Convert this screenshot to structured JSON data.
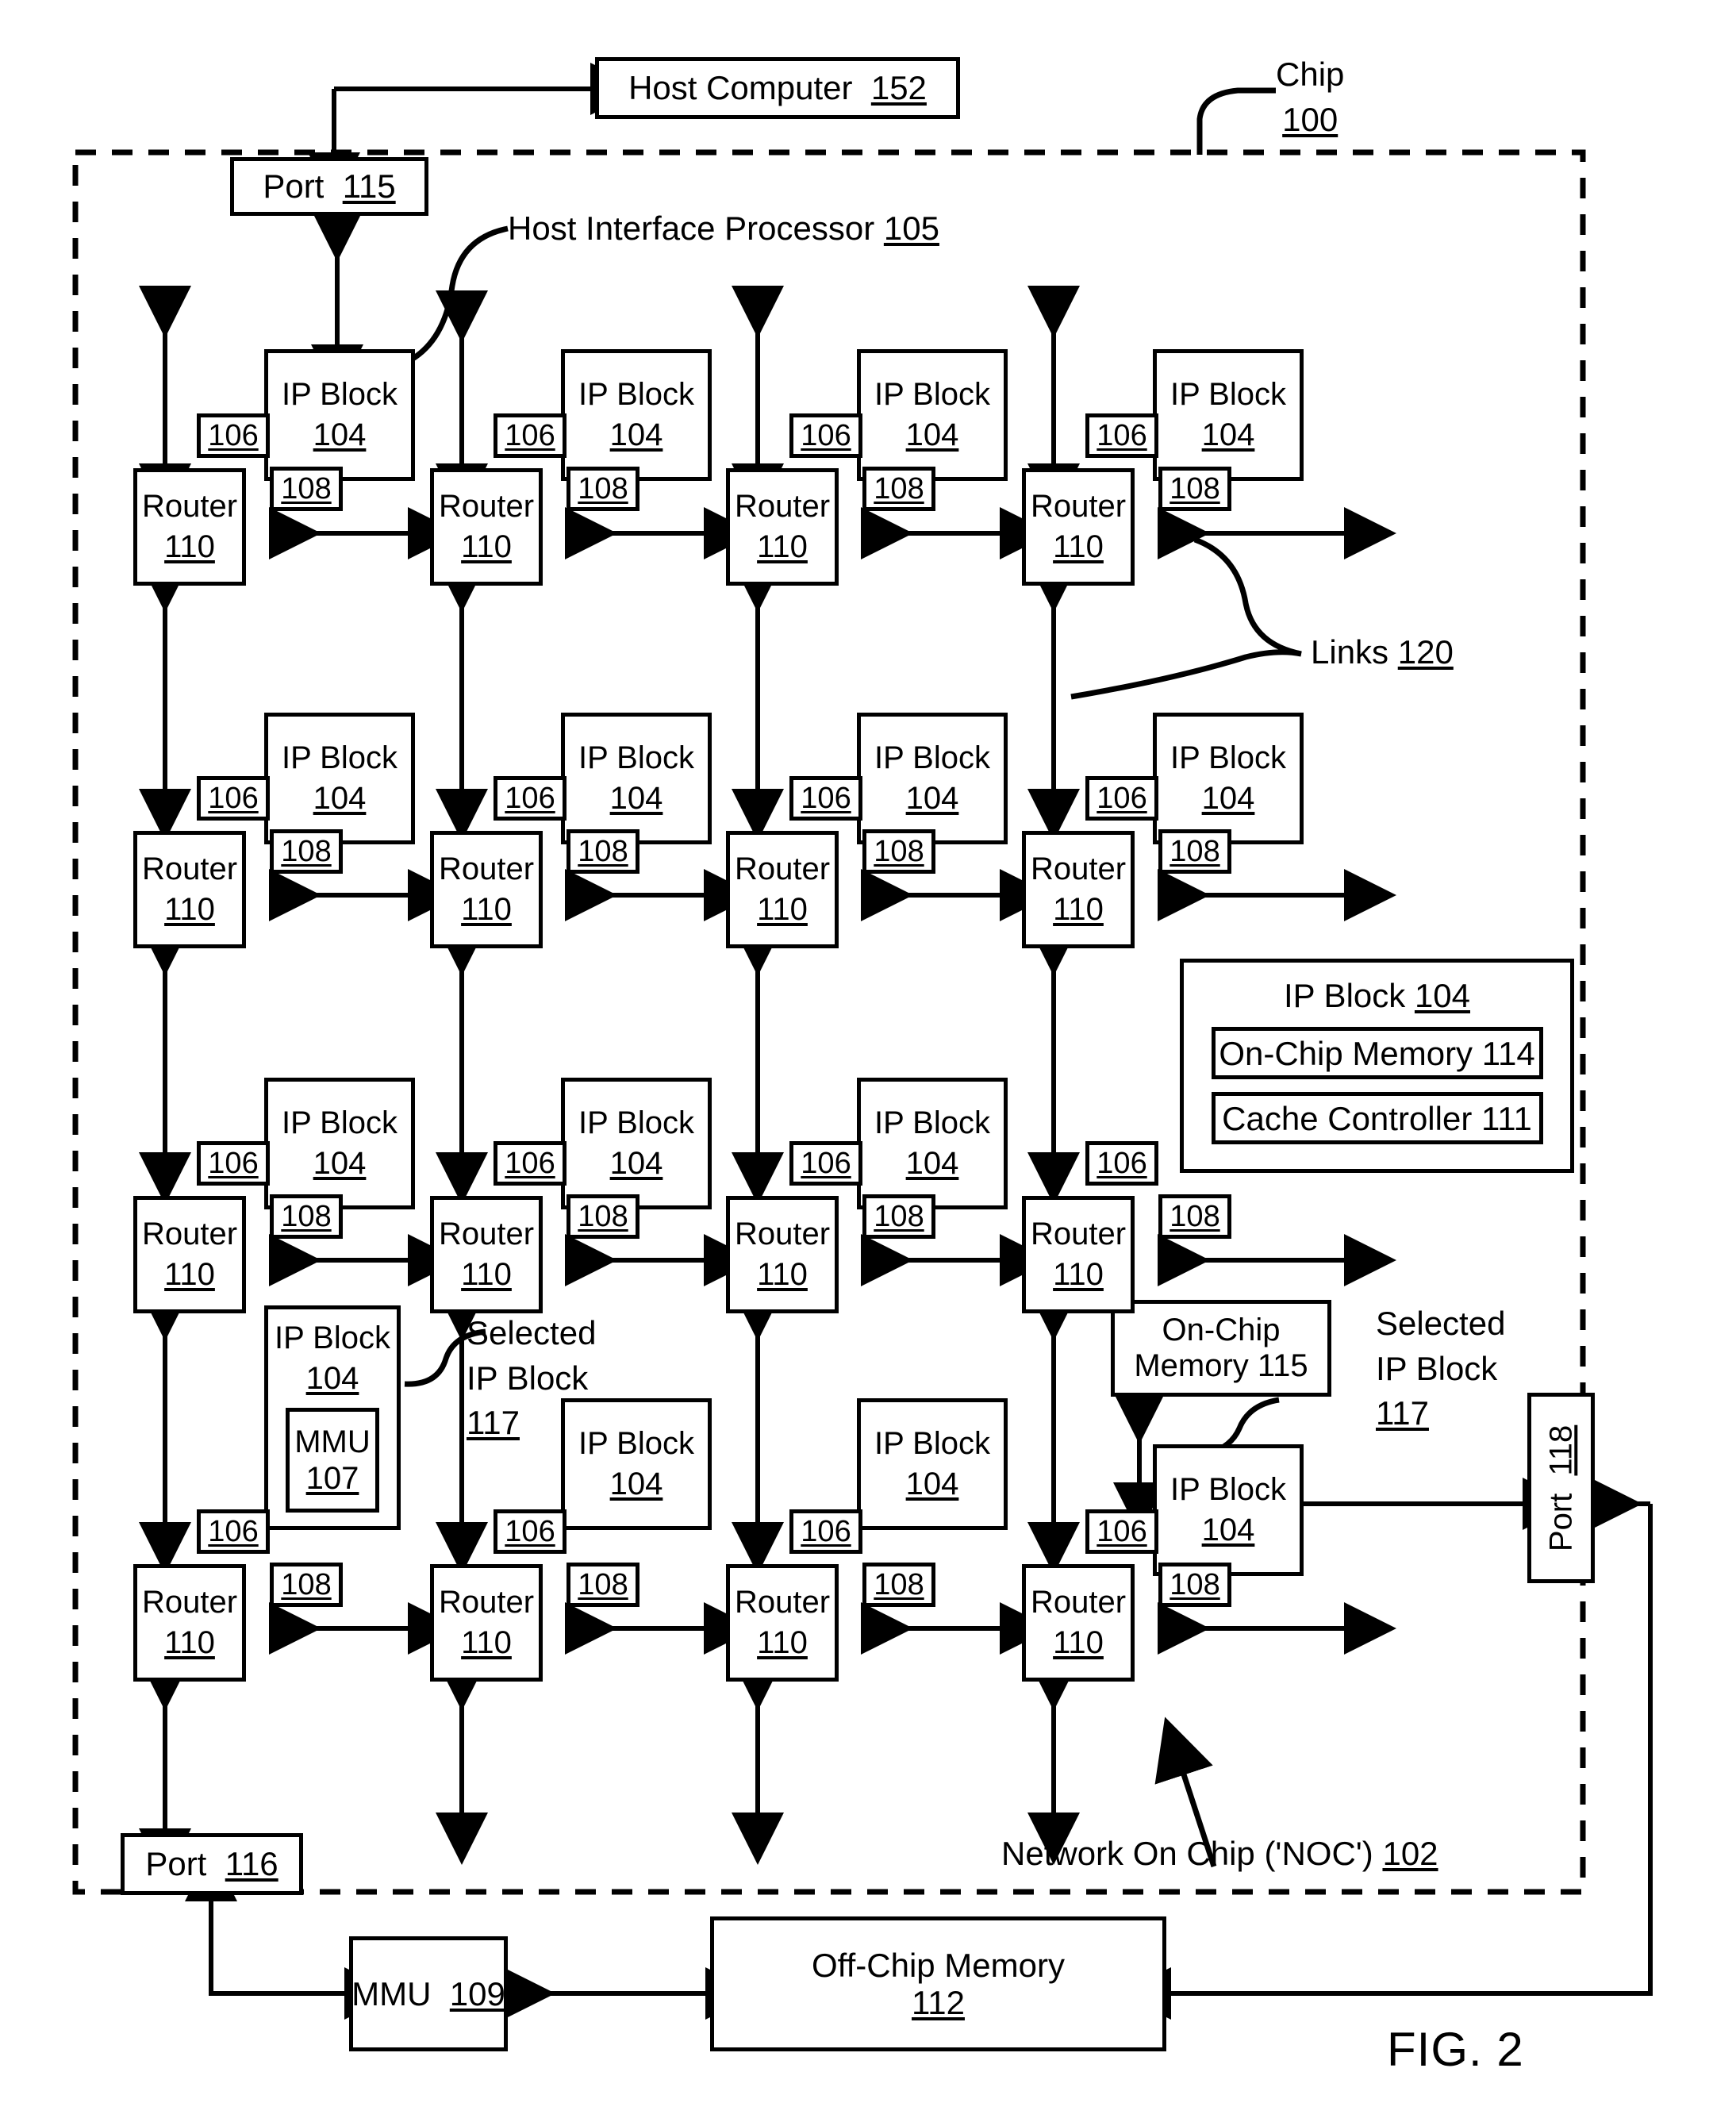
{
  "figure": {
    "number": "FIG. 2",
    "chip_label": {
      "line1": "Chip",
      "line2": "100"
    },
    "noc_label": "Network On Chip ('NOC') 102",
    "links_label": {
      "text": "Links",
      "ref": "120"
    },
    "host_interface_label": {
      "text": "Host Interface Processor",
      "ref": "105"
    },
    "selected_ip_left": {
      "line1": "Selected",
      "line2": "IP Block",
      "line3": "117"
    },
    "selected_ip_right": {
      "line1": "Selected",
      "line2": "IP Block",
      "line3": "117"
    }
  },
  "host_computer": {
    "title": "Host Computer",
    "ref": "152"
  },
  "ports": {
    "top": {
      "title": "Port",
      "ref": "115"
    },
    "bottom": {
      "title": "Port",
      "ref": "116"
    },
    "right": {
      "title": "Port",
      "ref": "118"
    }
  },
  "offchip": {
    "mmu": {
      "title": "MMU",
      "ref": "109"
    },
    "memory": {
      "title": "Off-Chip Memory",
      "ref": "112"
    }
  },
  "cell": {
    "ip_title": "IP Block",
    "ip_ref": "104",
    "router_title": "Router",
    "router_ref": "110",
    "tag_106": "106",
    "tag_108": "108"
  },
  "detail_ip_block": {
    "header_title": "IP Block",
    "header_ref": "104",
    "on_chip_memory": "On-Chip Memory 114",
    "cache_controller": "Cache Controller 111"
  },
  "mmu_in_ip": {
    "title": "MMU",
    "ref": "107"
  },
  "on_chip_memory_115": {
    "line1": "On-Chip",
    "line2": "Memory 115"
  },
  "grid": {
    "rows": 4,
    "cols": 4,
    "cells": [
      [
        {
          "type": "standard"
        },
        {
          "type": "standard"
        },
        {
          "type": "standard"
        },
        {
          "type": "standard"
        }
      ],
      [
        {
          "type": "standard"
        },
        {
          "type": "standard"
        },
        {
          "type": "standard"
        },
        {
          "type": "standard"
        }
      ],
      [
        {
          "type": "standard"
        },
        {
          "type": "standard"
        },
        {
          "type": "standard"
        },
        {
          "type": "detail"
        }
      ],
      [
        {
          "type": "mmu"
        },
        {
          "type": "standard"
        },
        {
          "type": "standard"
        },
        {
          "type": "selected"
        }
      ]
    ]
  },
  "colors": {
    "ink": "#000000",
    "paper": "#ffffff"
  }
}
